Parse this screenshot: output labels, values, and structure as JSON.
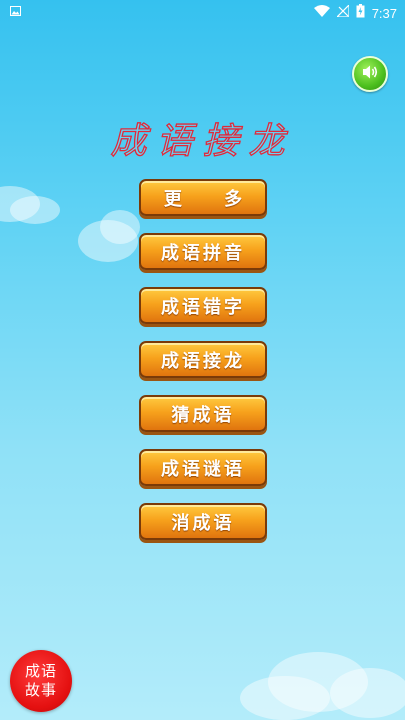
{
  "status_bar": {
    "time": "7:37"
  },
  "title": "成语接龙",
  "menu": {
    "items": [
      {
        "label": "更 多"
      },
      {
        "label": "成语拼音"
      },
      {
        "label": "成语错字"
      },
      {
        "label": "成语接龙"
      },
      {
        "label": "猜成语"
      },
      {
        "label": "成语谜语"
      },
      {
        "label": "消成语"
      }
    ]
  },
  "story_button": {
    "line1": "成语",
    "line2": "故事"
  }
}
